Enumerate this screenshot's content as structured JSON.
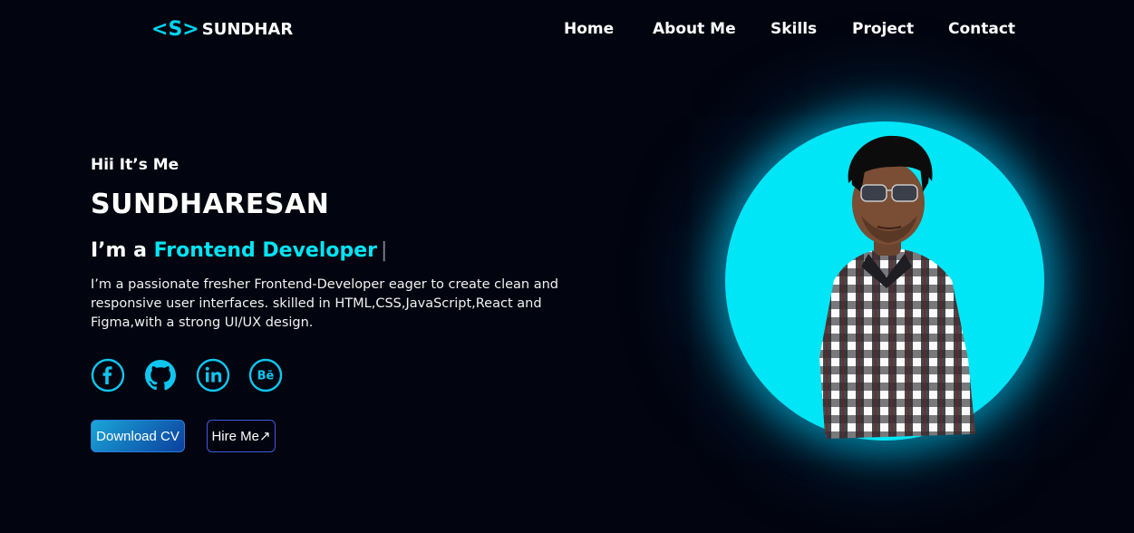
{
  "nav": {
    "logo_mark": "S",
    "logo_text": "SUNDHAR",
    "items": [
      "Home",
      "About Me",
      "Skills",
      "Project",
      "Contact"
    ]
  },
  "hero": {
    "greeting": "Hii It’s Me",
    "name": "SUNDHARESAN",
    "role_prefix": "I’m a",
    "role_highlight": "Frontend Developer",
    "cursor": "|",
    "description": "I’m a passionate fresher Frontend-Developer eager to create clean and responsive user interfaces. skilled in HTML,CSS,JavaScript,React and Figma,with a strong UI/UX design."
  },
  "socials": [
    {
      "icon": "facebook-icon"
    },
    {
      "icon": "github-icon"
    },
    {
      "icon": "linkedin-icon"
    },
    {
      "icon": "behance-icon",
      "label": "Bē"
    }
  ],
  "buttons": {
    "download_cv": "Download CV",
    "hire_me": "Hire Me↗"
  },
  "colors": {
    "background": "#02040f",
    "accent": "#00e5f5",
    "text": "#ffffff",
    "circle": "#00e6f6"
  }
}
